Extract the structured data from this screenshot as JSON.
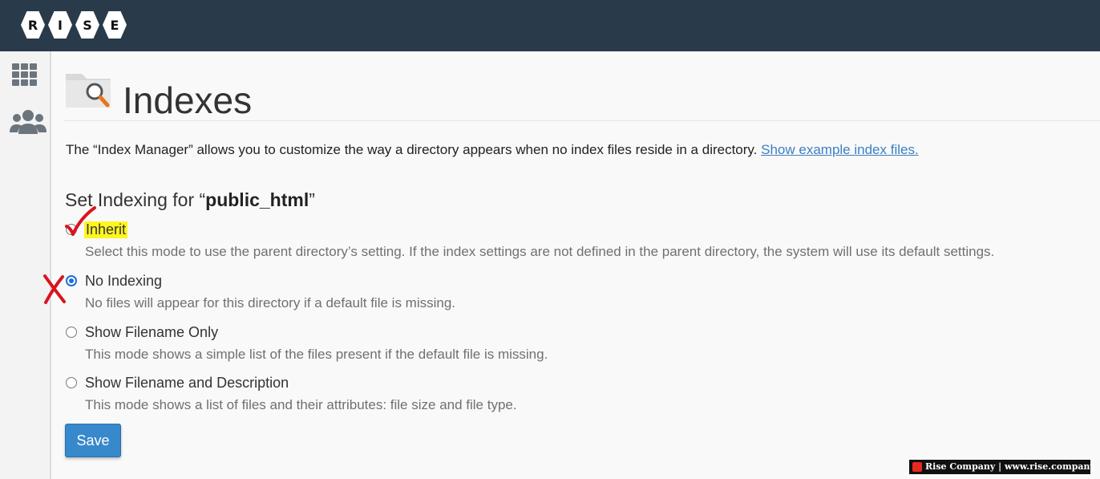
{
  "brand": {
    "logo_letters": [
      "R",
      "I",
      "S",
      "E"
    ]
  },
  "sidebar": {
    "items": [
      {
        "icon": "grid-icon",
        "name": "apps"
      },
      {
        "icon": "users-icon",
        "name": "users"
      }
    ]
  },
  "page": {
    "title": "Indexes",
    "icon": "folder-search-icon",
    "description": "The “Index Manager” allows you to customize the way a directory appears when no index files reside in a directory.",
    "description_link": "Show example index files."
  },
  "section": {
    "prefix": "Set Indexing for “",
    "directory": "public_html",
    "suffix": "”"
  },
  "options": [
    {
      "label": "Inherit",
      "help": "Select this mode to use the parent directory’s setting. If the index settings are not defined in the parent directory, the system will use its default settings.",
      "checked": false,
      "highlighted": true
    },
    {
      "label": "No Indexing",
      "help": "No files will appear for this directory if a default file is missing.",
      "checked": true,
      "highlighted": false
    },
    {
      "label": "Show Filename Only",
      "help": "This mode shows a simple list of the files present if the default file is missing.",
      "checked": false,
      "highlighted": false
    },
    {
      "label": "Show Filename and Description",
      "help": "This mode shows a list of files and their attributes: file size and file type.",
      "checked": false,
      "highlighted": false
    }
  ],
  "save_label": "Save",
  "annotations": {
    "check_color": "#d9141f",
    "cross_color": "#d9141f",
    "highlight_color": "#fff51f"
  },
  "watermark": {
    "text": "Rise Company | www.rise.company"
  },
  "colors": {
    "topbar": "#293a4a",
    "accent": "#3789cc",
    "link": "#3b80c4"
  }
}
